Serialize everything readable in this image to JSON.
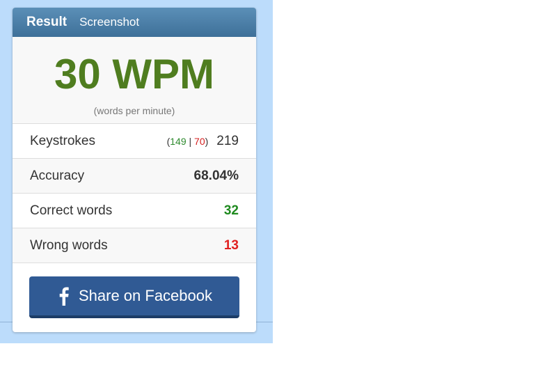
{
  "tabs": {
    "result": "Result",
    "screenshot": "Screenshot"
  },
  "wpm": {
    "value": "30 WPM",
    "subtitle": "(words per minute)"
  },
  "stats": {
    "keystrokes": {
      "label": "Keystrokes",
      "open": "(",
      "correct": "149",
      "sep": " | ",
      "wrong": "70",
      "close": ")",
      "total": "219"
    },
    "accuracy": {
      "label": "Accuracy",
      "value": "68.04%"
    },
    "correct_words": {
      "label": "Correct words",
      "value": "32"
    },
    "wrong_words": {
      "label": "Wrong words",
      "value": "13"
    }
  },
  "share": {
    "label": "Share on Facebook",
    "icon": "facebook-icon"
  },
  "colors": {
    "header": "#4a7fa8",
    "wpm": "#4f7d1f",
    "correct": "#1f8a1f",
    "wrong": "#e02020",
    "facebook": "#305a94"
  }
}
